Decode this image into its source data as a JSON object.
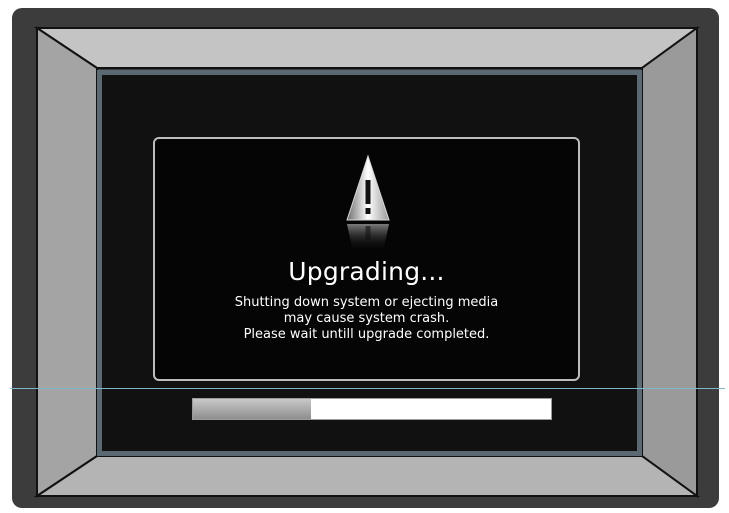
{
  "dialog": {
    "icon": "warning-triangle-icon",
    "title": "Upgrading...",
    "message_lines": [
      "Shutting down system or ejecting media",
      "may cause system crash.",
      "Please wait untill upgrade completed."
    ]
  },
  "progress": {
    "fraction": 0.33
  },
  "colors": {
    "device_frame": "#3c3c3c",
    "bezel": "#a9a9a9",
    "screen_border": "#5b6973",
    "screen_background": "#111111",
    "dialog_background": "#050505",
    "dialog_border": "#bdbdbd",
    "progress_fill": "#8e8e8e",
    "progress_track": "#ffffff",
    "guide_line": "#7fb6cc"
  }
}
